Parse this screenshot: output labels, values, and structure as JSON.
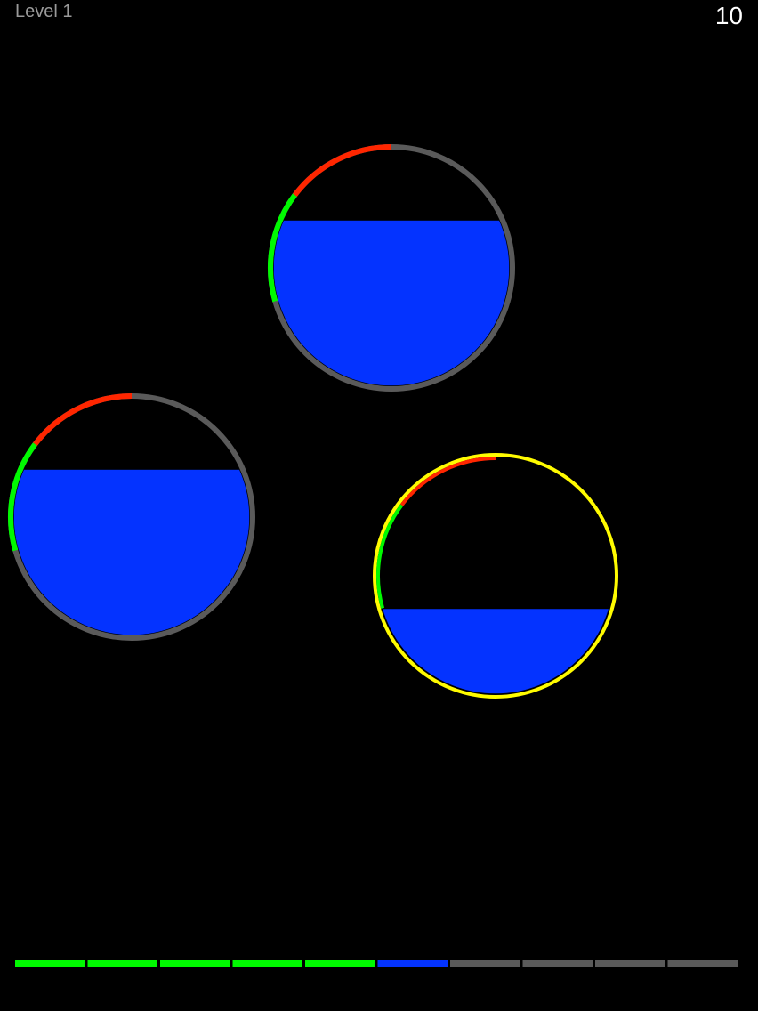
{
  "hud": {
    "level_label": "Level 1",
    "score": "10"
  },
  "colors": {
    "background": "#000000",
    "water": "#0433ff",
    "ring_gray": "#5a5a5a",
    "arc_red": "#ff2600",
    "arc_green": "#00f900",
    "ring_selected": "#fffb00",
    "progress_done": "#00f900",
    "progress_current": "#0433ff",
    "progress_pending": "#5a5a5a"
  },
  "tanks": [
    {
      "name": "tank-top",
      "fill_level": 0.7,
      "selected": false
    },
    {
      "name": "tank-left",
      "fill_level": 0.7,
      "selected": false
    },
    {
      "name": "tank-right",
      "fill_level": 0.36,
      "selected": true
    }
  ],
  "progress": {
    "segments": [
      "done",
      "done",
      "done",
      "done",
      "done",
      "current",
      "pending",
      "pending",
      "pending",
      "pending"
    ]
  }
}
